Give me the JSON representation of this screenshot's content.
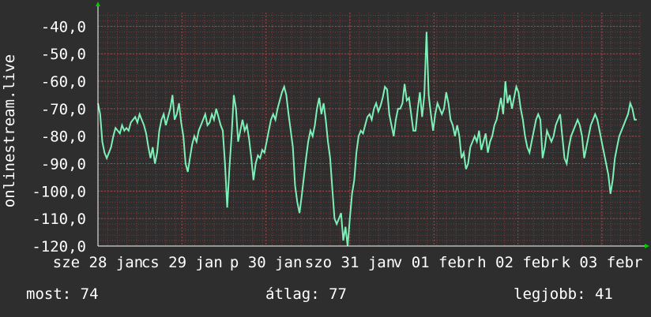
{
  "colors": {
    "background": "#2e2e2e",
    "plot_background": "#2e2e2e",
    "grid_minor": "#7a3a3a",
    "grid_major": "#9a4a4a",
    "series": "#7df0b8",
    "axis_arrow": "#00cc00",
    "text": "#ffffff"
  },
  "chart_data": {
    "type": "line",
    "ylabel": "onlinestream.live",
    "ylim": [
      -120,
      -35
    ],
    "yticks": [
      "-40,0",
      "-50,0",
      "-60,0",
      "-70,0",
      "-80,0",
      "-90,0",
      "-100,0",
      "-110,0",
      "-120,0"
    ],
    "ytick_values": [
      -40,
      -50,
      -60,
      -70,
      -80,
      -90,
      -100,
      -110,
      -120
    ],
    "xlim": [
      0,
      100
    ],
    "xticks": [
      {
        "label": "sze 28 jan",
        "x": 0
      },
      {
        "label": "cs 29 jan",
        "x": 15.5
      },
      {
        "label": "p 30 jan",
        "x": 31
      },
      {
        "label": "szo 31 jan",
        "x": 46.5
      },
      {
        "label": "v 01 febr",
        "x": 62
      },
      {
        "label": "h 02 febr",
        "x": 77.5
      },
      {
        "label": "k 03 febr",
        "x": 93
      }
    ],
    "grid": true,
    "series": [
      {
        "values": [
          -68,
          -72,
          -82,
          -86,
          -88,
          -86,
          -84,
          -80,
          -77,
          -78,
          -79,
          -76,
          -78,
          -77,
          -78,
          -75,
          -74,
          -73,
          -75,
          -72,
          -74,
          -76,
          -79,
          -84,
          -88,
          -84,
          -90,
          -86,
          -78,
          -74,
          -72,
          -76,
          -73,
          -70,
          -65,
          -74,
          -72,
          -68,
          -75,
          -80,
          -90,
          -93,
          -88,
          -83,
          -80,
          -82,
          -78,
          -76,
          -74,
          -72,
          -76,
          -75,
          -72,
          -74,
          -70,
          -73,
          -76,
          -78,
          -90,
          -106,
          -92,
          -80,
          -65,
          -70,
          -82,
          -78,
          -74,
          -78,
          -76,
          -81,
          -88,
          -96,
          -90,
          -87,
          -88,
          -85,
          -86,
          -82,
          -78,
          -74,
          -72,
          -74,
          -70,
          -67,
          -64,
          -62,
          -65,
          -72,
          -78,
          -84,
          -98,
          -104,
          -108,
          -102,
          -95,
          -88,
          -82,
          -78,
          -80,
          -76,
          -70,
          -66,
          -72,
          -68,
          -74,
          -82,
          -88,
          -99,
          -110,
          -112,
          -110,
          -108,
          -118,
          -113,
          -120,
          -110,
          -101,
          -96,
          -86,
          -80,
          -78,
          -79,
          -76,
          -73,
          -72,
          -74,
          -70,
          -68,
          -71,
          -69,
          -66,
          -62,
          -63,
          -72,
          -76,
          -80,
          -74,
          -70,
          -70,
          -68,
          -61,
          -67,
          -66,
          -72,
          -78,
          -78,
          -70,
          -64,
          -73,
          -65,
          -42,
          -65,
          -72,
          -78,
          -72,
          -68,
          -70,
          -72,
          -70,
          -64,
          -68,
          -74,
          -76,
          -80,
          -76,
          -80,
          -88,
          -86,
          -92,
          -90,
          -84,
          -82,
          -80,
          -82,
          -78,
          -85,
          -82,
          -79,
          -86,
          -82,
          -80,
          -76,
          -74,
          -70,
          -66,
          -72,
          -60,
          -68,
          -65,
          -70,
          -66,
          -62,
          -64,
          -70,
          -74,
          -80,
          -84,
          -86,
          -82,
          -78,
          -74,
          -72,
          -74,
          -88,
          -84,
          -78,
          -80,
          -82,
          -80,
          -76,
          -74,
          -72,
          -80,
          -88,
          -90,
          -84,
          -80,
          -78,
          -76,
          -74,
          -76,
          -80,
          -88,
          -84,
          -80,
          -76,
          -74,
          -72,
          -74,
          -78,
          -82,
          -86,
          -90,
          -94,
          -101,
          -96,
          -88,
          -84,
          -80,
          -78,
          -76,
          -74,
          -72,
          -68,
          -70,
          -74,
          -74
        ]
      }
    ],
    "stats": {
      "current_label": "most:",
      "current_value": "74",
      "average_label": "átlag:",
      "average_value": "77",
      "best_label": "legjobb:",
      "best_value": "41"
    }
  }
}
